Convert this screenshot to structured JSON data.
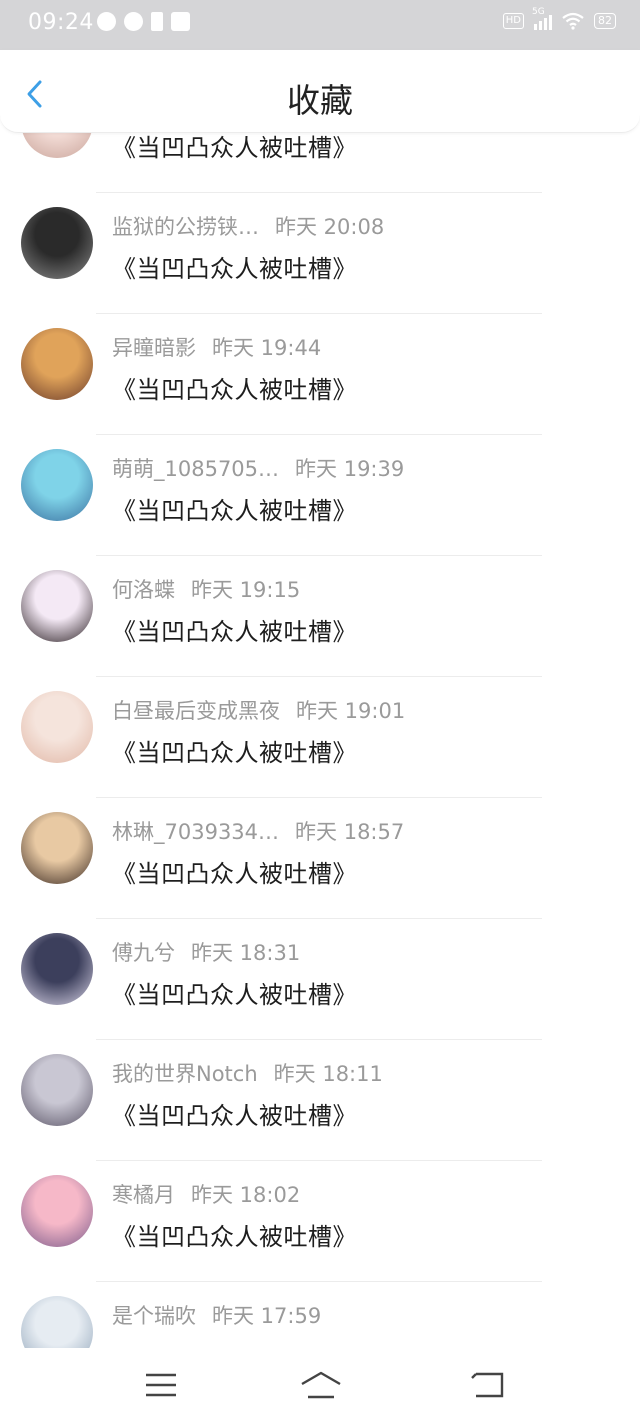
{
  "status_bar": {
    "time": "09:24",
    "network": "5G",
    "hd": "HD",
    "battery": "82",
    "app_icons": [
      "compass-icon",
      "weather-icon",
      "tiktok-icon",
      "app-grid-icon"
    ]
  },
  "header": {
    "title": "收藏",
    "accent_color": "#3d9fe6"
  },
  "items": [
    {
      "name": "",
      "time": "",
      "title": "《当凹凸众人被吐槽》",
      "avatar_colors": [
        "#f3dcd6",
        "#c9a49a"
      ]
    },
    {
      "name": "监狱的公捞铗…",
      "time": "昨天  20:08",
      "title": "《当凹凸众人被吐槽》",
      "avatar_colors": [
        "#2a2a2a",
        "#8a8a8a"
      ]
    },
    {
      "name": "异瞳暗影",
      "time": "昨天  19:44",
      "title": "《当凹凸众人被吐槽》",
      "avatar_colors": [
        "#e0a35a",
        "#6b3b2a"
      ]
    },
    {
      "name": "萌萌_1085705…",
      "time": "昨天  19:39",
      "title": "《当凹凸众人被吐槽》",
      "avatar_colors": [
        "#7fd3e8",
        "#3a6f9f"
      ]
    },
    {
      "name": "何洛蝶",
      "time": "昨天  19:15",
      "title": "《当凹凸众人被吐槽》",
      "avatar_colors": [
        "#f4e9f5",
        "#2b2024"
      ]
    },
    {
      "name": "白昼最后变成黑夜",
      "time": "昨天  19:01",
      "title": "《当凹凸众人被吐槽》",
      "avatar_colors": [
        "#f5e4dc",
        "#e1b7a6"
      ]
    },
    {
      "name": "林琳_7039334…",
      "time": "昨天  18:57",
      "title": "《当凹凸众人被吐槽》",
      "avatar_colors": [
        "#e8c9a3",
        "#3b2a22"
      ]
    },
    {
      "name": "傅九兮",
      "time": "昨天  18:31",
      "title": "《当凹凸众人被吐槽》",
      "avatar_colors": [
        "#3c3f5c",
        "#d8d3e6"
      ]
    },
    {
      "name": "我的世界Notch",
      "time": "昨天  18:11",
      "title": "《当凹凸众人被吐槽》",
      "avatar_colors": [
        "#c9c7d3",
        "#5a5466"
      ]
    },
    {
      "name": "寒橘月",
      "time": "昨天  18:02",
      "title": "《当凹凸众人被吐槽》",
      "avatar_colors": [
        "#f6b8c8",
        "#7b5a8a"
      ]
    },
    {
      "name": "是个瑞吹",
      "time": "昨天  17:59",
      "title": "",
      "avatar_colors": [
        "#e6ecf2",
        "#8fa3b8"
      ]
    }
  ],
  "nav_bar": {
    "buttons": [
      "menu-icon",
      "home-icon",
      "back-icon"
    ]
  }
}
